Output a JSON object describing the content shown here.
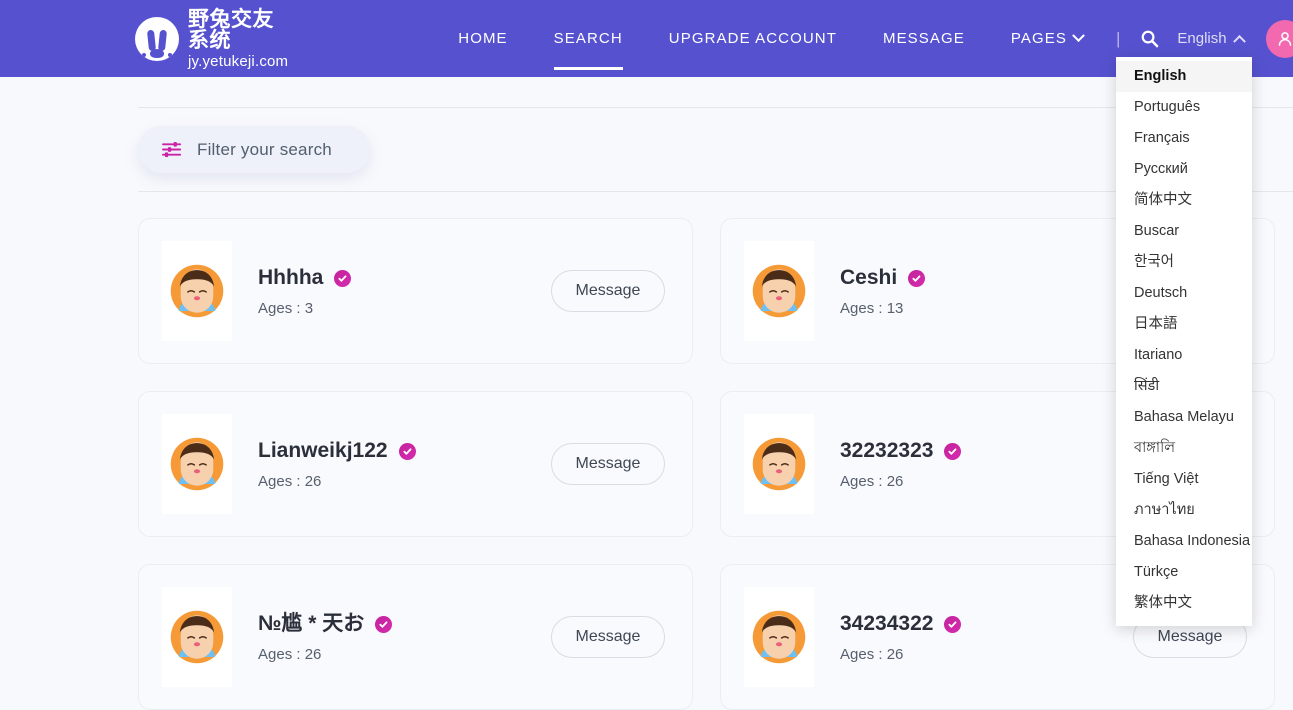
{
  "brand": {
    "logo_icon": "rabbit-logo-icon",
    "name_cn": "野兔交友系统",
    "url": "jy.yetukeji.com"
  },
  "nav": {
    "links": [
      {
        "label": "HOME",
        "active": false,
        "caret": false
      },
      {
        "label": "SEARCH",
        "active": true,
        "caret": false
      },
      {
        "label": "UPGRADE ACCOUNT",
        "active": false,
        "caret": false
      },
      {
        "label": "MESSAGE",
        "active": false,
        "caret": false
      },
      {
        "label": "PAGES",
        "active": false,
        "caret": true
      }
    ],
    "separator": "|",
    "search_icon": "search-icon",
    "language_label": "English",
    "language_caret": "chevron-up-icon",
    "avatar_icon": "user-avatar-icon",
    "avatar_caret": "chevron-down-icon",
    "bar_color": "#5652cf",
    "avatar_color": "#f269b0"
  },
  "language_menu": {
    "open": true,
    "selected": "English",
    "items": [
      "English",
      "Português",
      "Français",
      "Русский",
      "简体中文",
      "Buscar",
      "한국어",
      "Deutsch",
      "日本語",
      "Itariano",
      "सिंडी",
      "Bahasa Melayu",
      "বাঙ্গালি",
      "Tiếng Việt",
      "ภาษาไทย",
      "Bahasa Indonesia",
      "Türkçe",
      "繁体中文"
    ]
  },
  "filter": {
    "icon": "sliders-icon",
    "label": "Filter your search",
    "icon_color": "#cc22a8"
  },
  "results": {
    "message_button_label": "Message",
    "verified_icon": "verified-check-icon",
    "cards": [
      {
        "name": "Hhhha",
        "age_label": "Ages : 3",
        "verified": true
      },
      {
        "name": "Ceshi",
        "age_label": "Ages : 13",
        "verified": true
      },
      {
        "name": "Lianweikj122",
        "age_label": "Ages : 26",
        "verified": true
      },
      {
        "name": "32232323",
        "age_label": "Ages : 26",
        "verified": true
      },
      {
        "name": "№尴 * 天お",
        "age_label": "Ages : 26",
        "verified": true
      },
      {
        "name": "34234322",
        "age_label": "Ages : 26",
        "verified": true
      }
    ]
  }
}
